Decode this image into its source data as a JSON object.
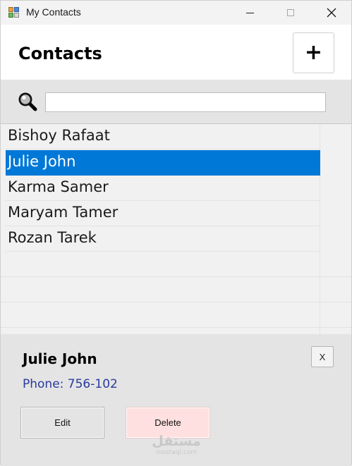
{
  "window": {
    "title": "My Contacts"
  },
  "header": {
    "title": "Contacts",
    "add_label": "+"
  },
  "search": {
    "value": "",
    "placeholder": ""
  },
  "contacts": {
    "items": [
      {
        "name": "Bishoy Rafaat",
        "selected": false
      },
      {
        "name": "Julie John",
        "selected": true
      },
      {
        "name": "Karma Samer",
        "selected": false
      },
      {
        "name": "Maryam Tamer",
        "selected": false
      },
      {
        "name": "Rozan Tarek",
        "selected": false
      }
    ]
  },
  "details": {
    "name": "Julie John",
    "phone": "Phone: 756-102",
    "close_label": "X",
    "edit_label": "Edit",
    "delete_label": "Delete"
  },
  "watermark": {
    "mark": "مستقل",
    "text": "mostaql.com"
  },
  "colors": {
    "selection": "#0078d7",
    "phone_text": "#2a3a9c",
    "delete_bg": "#ffe0e0",
    "panel_bg": "#e4e4e4"
  },
  "icons": {
    "app": "app-icon",
    "search": "search-icon",
    "minimize": "minimize-icon",
    "maximize": "maximize-icon",
    "close": "close-icon"
  }
}
